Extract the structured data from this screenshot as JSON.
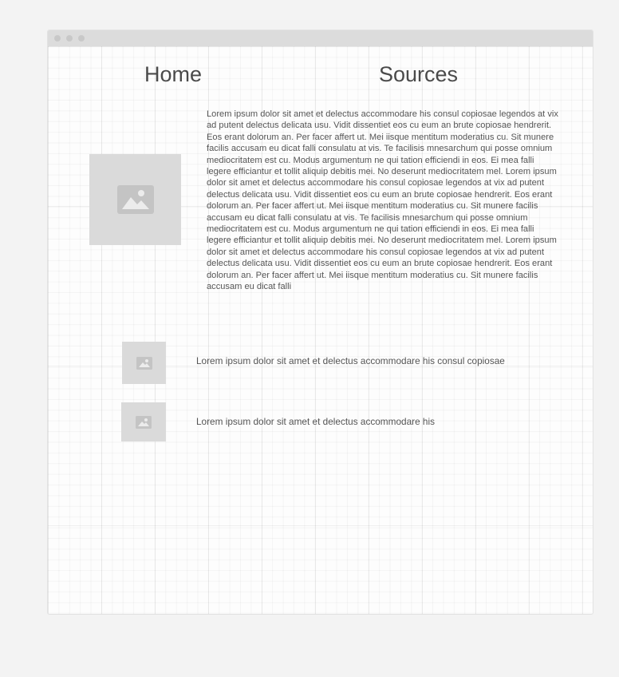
{
  "nav": {
    "home_label": "Home",
    "sources_label": "Sources"
  },
  "main": {
    "hero_image_icon": "image-placeholder-icon",
    "paragraph": "Lorem ipsum dolor sit amet et delectus accommodare his consul copiosae legendos at vix ad putent delectus delicata usu. Vidit dissentiet eos cu eum an brute copiosae hendrerit. Eos erant dolorum an. Per facer affert ut. Mei iisque mentitum moderatius cu. Sit munere facilis accusam eu dicat falli consulatu at vis. Te facilisis mnesarchum qui posse omnium mediocritatem est cu. Modus argumentum ne qui tation efficiendi in eos. Ei mea falli legere efficiantur et tollit aliquip debitis mei. No deserunt mediocritatem mel. Lorem ipsum dolor sit amet et delectus accommodare his consul copiosae legendos at vix ad putent delectus delicata usu. Vidit dissentiet eos cu eum an brute copiosae hendrerit. Eos erant dolorum an. Per facer affert ut. Mei iisque mentitum moderatius cu. Sit munere facilis accusam eu dicat falli consulatu at vis. Te facilisis mnesarchum qui posse omnium mediocritatem est cu. Modus argumentum ne qui tation efficiendi in eos. Ei mea falli legere efficiantur et tollit aliquip debitis mei. No deserunt mediocritatem mel. Lorem ipsum dolor sit amet et delectus accommodare his consul copiosae legendos at vix ad putent delectus delicata usu. Vidit dissentiet eos cu eum an brute copiosae hendrerit. Eos erant dolorum an. Per facer affert ut. Mei iisque mentitum moderatius cu. Sit munere facilis accusam eu dicat falli"
  },
  "list": {
    "items": [
      {
        "text": "Lorem ipsum dolor sit amet et delectus accommodare his consul copiosae",
        "icon": "image-placeholder-icon"
      },
      {
        "text": "Lorem ipsum dolor sit amet et delectus accommodare his",
        "icon": "image-placeholder-icon"
      }
    ]
  },
  "colors": {
    "page_background": "#f3f3f3",
    "titlebar": "#dcdcdc",
    "placeholder": "#dadada",
    "text": "#555555"
  }
}
